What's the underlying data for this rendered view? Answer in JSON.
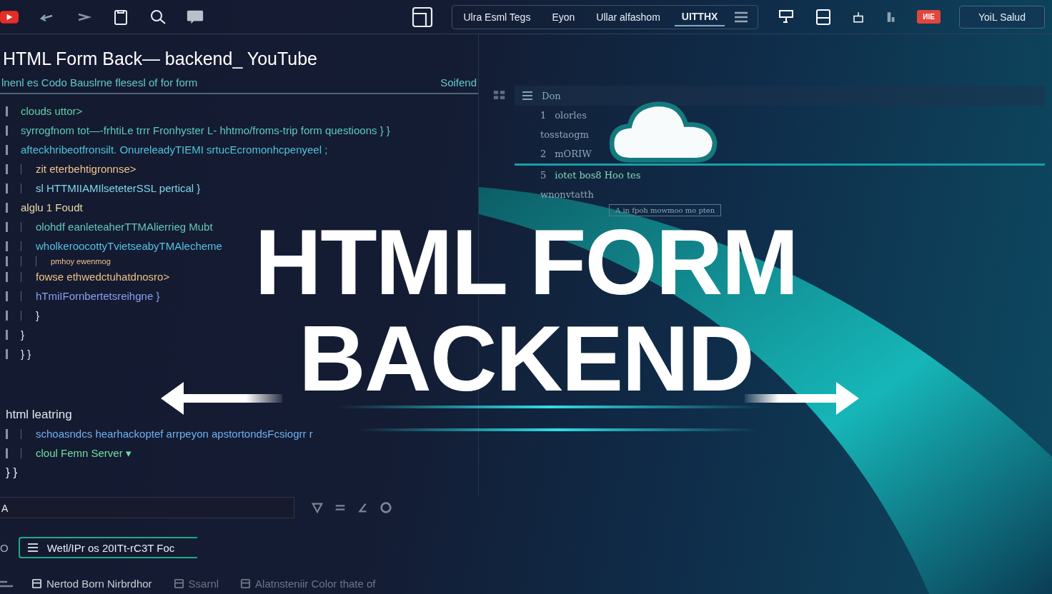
{
  "toolbar": {
    "tabs": [
      {
        "label": "Ulra Esml Tegs",
        "selected": false
      },
      {
        "label": "Eyon",
        "selected": false
      },
      {
        "label": "Ullar alfashom",
        "selected": false
      },
      {
        "label": "UITTHX",
        "selected": true
      }
    ],
    "badge": "ИIE",
    "account_button": "YoiL Salud"
  },
  "editor": {
    "title": "HTML Form Back— backend_ YouTube",
    "subtitle": "lnenl es Codo Bauslrne flesesl of for form",
    "subtitle_action": "Soifend",
    "lines": [
      {
        "text": "clouds uttor>",
        "color": "#5fd0a8"
      },
      {
        "text": "syrrogfnom tot—-frhtiLe trrr Fronhyster L- hhtmo/froms-trip form questioons } }",
        "color": "#5cc9c0"
      },
      {
        "text": "afteckhribeotfronsilt. OnureleadyTIEMI srtucEcromonhcpenyeel ;",
        "color": "#4fc3d9",
        "children": [
          {
            "text": "zit eterbehtigronnse>",
            "color": "#f2c48a"
          },
          {
            "text": "sl HTTMIIAMIlseteterSSL pertical }",
            "color": "#7fd6e8"
          }
        ]
      },
      {
        "text": "alglu 1 Foudt",
        "color": "#e8d9a8",
        "children": [
          {
            "text": "olohdf eanleteaherTTMAlierrieg Mubt",
            "color": "#62c7b8"
          },
          {
            "text": "wholkeroocottyTvietseabyTMAlecheme",
            "color": "#55c2e0",
            "children": [
              {
                "text": "pmhoy ewenmog",
                "color": "#f2c48a"
              }
            ]
          },
          {
            "text": "fowse ethwedctuhatdnosro>",
            "color": "#f0c080"
          },
          {
            "text": "hTmiIFornbertetsreihgne }",
            "color": "#8f9ff0"
          },
          {
            "text": "}",
            "color": "#dfe6ee"
          }
        ]
      },
      {
        "text": "}",
        "color": "#dfe6ee"
      },
      {
        "text": "} }",
        "color": "#dfe6ee"
      }
    ],
    "lines_lower": [
      {
        "text": "html leatring",
        "color": "#dfe6ee",
        "children": [
          {
            "text": "schoasndcs hearhackoptef arrpeyon apstortondsFcsiogrr r",
            "color": "#6fb0f0"
          },
          {
            "text": "cloul Femn Server ▾",
            "color": "#6ee0a0"
          }
        ]
      },
      {
        "text": "} }",
        "color": "#dfe6ee"
      }
    ]
  },
  "outline": {
    "header": "Don",
    "items": [
      {
        "number": "1",
        "text": "olorles",
        "selected": false
      },
      {
        "text": "tosstaogm",
        "selected": false
      },
      {
        "number": "2",
        "text": "mORIW",
        "selected": false
      },
      {
        "number": "5",
        "text": "iotet bos8 Hoo tes",
        "selected": true
      },
      {
        "text": "wnonvtatth",
        "selected": false
      }
    ],
    "note": "A in fpoh mowmoo mo pten"
  },
  "headline": {
    "line1": "HTML FORM",
    "line2": "BACKEND"
  },
  "command_field": {
    "value": "A"
  },
  "status": {
    "prefix": "O",
    "value": "Wetl/IPr os 20ITt-rC3T Foc"
  },
  "bottom_tabs": [
    {
      "label": "Nertod Born Nirbrdhor",
      "selected": true
    },
    {
      "label": "Ssarnl",
      "selected": false
    },
    {
      "label": "Alatnsteniir Color thate of",
      "selected": false
    }
  ]
}
